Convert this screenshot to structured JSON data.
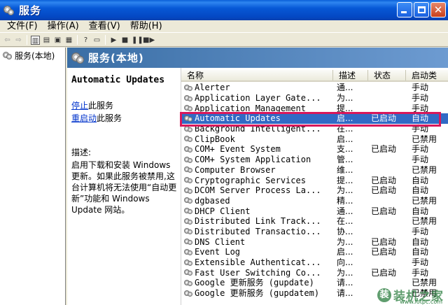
{
  "window": {
    "title": "服务"
  },
  "menu": [
    "文件(F)",
    "操作(A)",
    "查看(V)",
    "帮助(H)"
  ],
  "tree": {
    "root": "服务(本地)"
  },
  "header": {
    "title": "服务(本地)"
  },
  "details": {
    "service_name": "Automatic Updates",
    "stop_link": "停止",
    "stop_suffix": "此服务",
    "restart_link": "重启动",
    "restart_suffix": "此服务",
    "description_label": "描述:",
    "description": "启用下载和安装 Windows 更新。如果此服务被禁用,这台计算机将无法使用“自动更新”功能和 Windows Update 网站。"
  },
  "columns": {
    "name": "名称",
    "description": "描述",
    "status": "状态",
    "startup": "启动类"
  },
  "services": [
    {
      "name": "Alerter",
      "desc": "通...",
      "status": "",
      "startup": "手动"
    },
    {
      "name": "Application Layer Gate...",
      "desc": "为...",
      "status": "",
      "startup": "手动"
    },
    {
      "name": "Application Management",
      "desc": "提...",
      "status": "",
      "startup": "手动"
    },
    {
      "name": "Automatic Updates",
      "desc": "启...",
      "status": "已启动",
      "startup": "自动"
    },
    {
      "name": "Background Intelligent...",
      "desc": "在...",
      "status": "",
      "startup": "手动"
    },
    {
      "name": "ClipBook",
      "desc": "启...",
      "status": "",
      "startup": "已禁用"
    },
    {
      "name": "COM+ Event System",
      "desc": "支...",
      "status": "已启动",
      "startup": "手动"
    },
    {
      "name": "COM+ System Application",
      "desc": "管...",
      "status": "",
      "startup": "手动"
    },
    {
      "name": "Computer Browser",
      "desc": "维...",
      "status": "",
      "startup": "已禁用"
    },
    {
      "name": "Cryptographic Services",
      "desc": "提...",
      "status": "已启动",
      "startup": "自动"
    },
    {
      "name": "DCOM Server Process La...",
      "desc": "为...",
      "status": "已启动",
      "startup": "自动"
    },
    {
      "name": "dgbased",
      "desc": "精...",
      "status": "",
      "startup": "已禁用"
    },
    {
      "name": "DHCP Client",
      "desc": "通...",
      "status": "已启动",
      "startup": "自动"
    },
    {
      "name": "Distributed Link Track...",
      "desc": "在...",
      "status": "",
      "startup": "已禁用"
    },
    {
      "name": "Distributed Transactio...",
      "desc": "协...",
      "status": "",
      "startup": "手动"
    },
    {
      "name": "DNS Client",
      "desc": "为...",
      "status": "已启动",
      "startup": "自动"
    },
    {
      "name": "Event Log",
      "desc": "启...",
      "status": "已启动",
      "startup": "自动"
    },
    {
      "name": "Extensible Authenticat...",
      "desc": "向...",
      "status": "",
      "startup": "手动"
    },
    {
      "name": "Fast User Switching Co...",
      "desc": "为...",
      "status": "已启动",
      "startup": "手动"
    },
    {
      "name": "Google 更新服务 (gupdate)",
      "desc": "请...",
      "status": "",
      "startup": "已禁用"
    },
    {
      "name": "Google 更新服务 (gupdatem)",
      "desc": "请...",
      "status": "",
      "startup": "已禁用"
    }
  ],
  "selected_index": 3,
  "watermark": {
    "logo": "装",
    "text": "装机之家",
    "url": "www.lotpc.com"
  }
}
